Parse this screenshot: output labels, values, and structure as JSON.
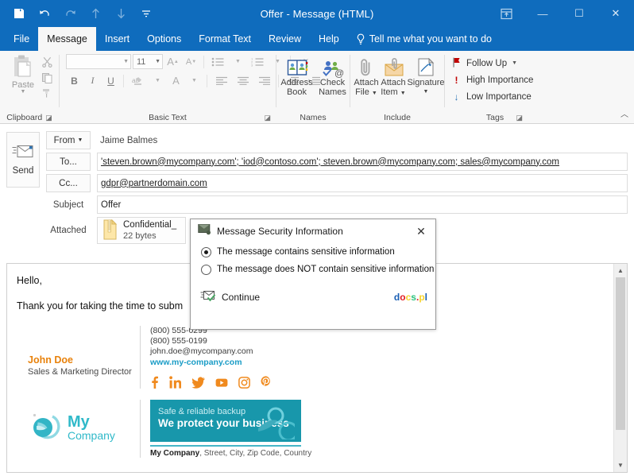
{
  "window": {
    "title": "Offer  -  Message (HTML)",
    "quick_access": [
      {
        "name": "save-icon",
        "label": "Save"
      },
      {
        "name": "undo-icon",
        "label": "Undo"
      },
      {
        "name": "redo-icon",
        "label": "Redo"
      },
      {
        "name": "previous-item-icon",
        "label": "Previous Item"
      },
      {
        "name": "next-item-icon",
        "label": "Next Item"
      },
      {
        "name": "customize-quick-access-toolbar-icon",
        "label": "Customize Quick Access Toolbar"
      }
    ],
    "controls": [
      {
        "name": "ribbon-display-options-icon",
        "glyph": "⌧"
      },
      {
        "name": "minimize-button",
        "glyph": "—"
      },
      {
        "name": "maximize-button",
        "glyph": "☐"
      },
      {
        "name": "close-button",
        "glyph": "✕"
      }
    ]
  },
  "tabs": [
    {
      "label": "File",
      "active": false
    },
    {
      "label": "Message",
      "active": true
    },
    {
      "label": "Insert",
      "active": false
    },
    {
      "label": "Options",
      "active": false
    },
    {
      "label": "Format Text",
      "active": false
    },
    {
      "label": "Review",
      "active": false
    },
    {
      "label": "Help",
      "active": false
    }
  ],
  "tell_me": "Tell me what you want to do",
  "ribbon": {
    "groups": [
      {
        "label": "Clipboard",
        "has_launcher": true
      },
      {
        "label": "Basic Text",
        "has_launcher": true
      },
      {
        "label": "Names",
        "has_launcher": false
      },
      {
        "label": "Include",
        "has_launcher": false
      },
      {
        "label": "Tags",
        "has_launcher": true
      }
    ],
    "clipboard": {
      "paste_label": "Paste",
      "cut_label": "Cut",
      "copy_label": "Copy",
      "format_painter_label": "Format Painter"
    },
    "basic_text": {
      "font_name": "",
      "font_name_placeholder": "",
      "font_size": "11",
      "buttons": [
        "grow-font",
        "shrink-font",
        "bullets",
        "numbering",
        "clear-formatting",
        "bold",
        "italic",
        "underline",
        "text-highlight-color",
        "font-color",
        "align-left",
        "align-center",
        "align-right",
        "decrease-indent",
        "increase-indent"
      ]
    },
    "names": {
      "address_book_line1": "Address",
      "address_book_line2": "Book",
      "check_names_line1": "Check",
      "check_names_line2": "Names"
    },
    "include": {
      "attach_file_line1": "Attach",
      "attach_file_line2": "File",
      "attach_item_line1": "Attach",
      "attach_item_line2": "Item",
      "signature_label": "Signature"
    },
    "tags": {
      "follow_up": "Follow Up",
      "high_importance": "High Importance",
      "low_importance": "Low Importance"
    }
  },
  "compose": {
    "send_label": "Send",
    "from_label": "From",
    "from_value": "Jaime Balmes",
    "to_label": "To...",
    "to_value": "'steven.brown@mycompany.com'; 'iod@contoso.com'; steven.brown@mycompany.com; sales@mycompany.com",
    "cc_label": "Cc...",
    "cc_value": "gdpr@partnerdomain.com",
    "subject_label": "Subject",
    "subject_value": "Offer",
    "attached_label": "Attached",
    "attachment": {
      "name": "Confidential_",
      "size": "22 bytes",
      "icon": "zip-file-icon"
    }
  },
  "body": {
    "greeting": "Hello,",
    "paragraph": "Thank you for taking the time to subm",
    "signature": {
      "name": "John Doe",
      "title": "Sales & Marketing Director",
      "phone1": "(800) 555-0299",
      "phone2": "(800) 555-0199",
      "email": "john.doe@mycompany.com",
      "website": "www.my-company.com",
      "social": [
        {
          "name": "facebook-icon",
          "label": "Facebook"
        },
        {
          "name": "linkedin-icon",
          "label": "LinkedIn"
        },
        {
          "name": "twitter-icon",
          "label": "Twitter"
        },
        {
          "name": "youtube-icon",
          "label": "YouTube"
        },
        {
          "name": "instagram-icon",
          "label": "Instagram"
        },
        {
          "name": "pinterest-icon",
          "label": "Pinterest"
        }
      ],
      "logo_line1": "My",
      "logo_line2": "Company",
      "banner_line1": "Safe & reliable backup",
      "banner_line2": "We protect your business",
      "address_company": "My Company",
      "address_rest": ", Street, City, Zip Code, Country"
    }
  },
  "dialog": {
    "icon": "secure-message-icon",
    "title": "Message Security Information",
    "close_glyph": "✕",
    "options": [
      {
        "label": "The message contains sensitive information",
        "selected": true
      },
      {
        "label": "The message does NOT contain sensitive information",
        "selected": false
      }
    ],
    "continue_label": "Continue",
    "brand": {
      "letters": [
        {
          "char": "d",
          "color": "#1a5fb4"
        },
        {
          "char": "o",
          "color": "#e01b24"
        },
        {
          "char": "c",
          "color": "#f6d32d"
        },
        {
          "char": "s",
          "color": "#2ec27e"
        },
        {
          "char": ".",
          "color": "#e01b24"
        },
        {
          "char": "p",
          "color": "#f6d32d"
        },
        {
          "char": "l",
          "color": "#1a5fb4"
        }
      ]
    }
  },
  "scrollbar": {
    "up_glyph": "▲",
    "down_glyph": "▼"
  },
  "colors": {
    "ribbon_blue": "#0f6cbd",
    "accent_orange": "#e8820c",
    "brand_teal": "#30b9c9",
    "link_blue": "#1a9cc6"
  }
}
